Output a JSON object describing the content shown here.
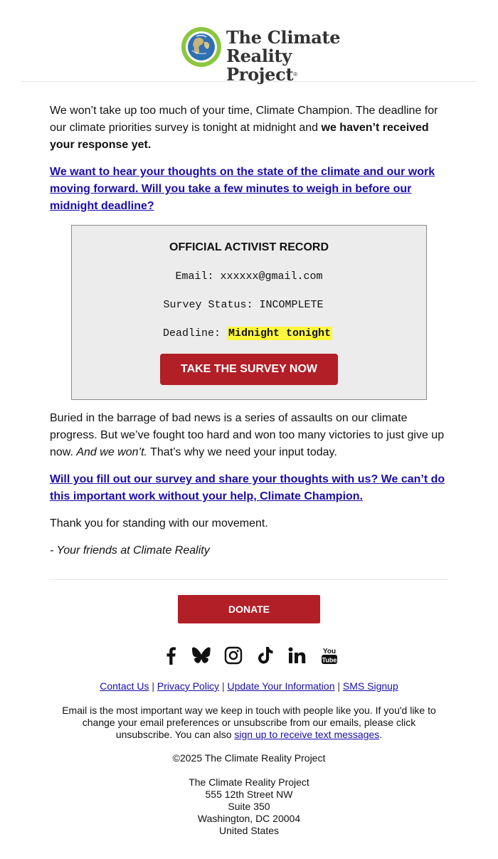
{
  "header": {
    "logo_line1": "The Climate",
    "logo_line2": "Reality Project",
    "logo_reg": "®"
  },
  "body": {
    "p1_normal": "We won’t take up too much of your time, Climate Champion. The deadline for our climate priorities survey is tonight at midnight and ",
    "p1_bold": "we haven’t received your response yet.",
    "link1": "We want to hear your thoughts on the state of the climate and our work moving forward. Will you take a few minutes to weigh in before our midnight deadline?",
    "p3_normal": "Buried in the barrage of bad news is a series of assaults on our climate progress. But we’ve fought too hard and won too many victories to just give up now. ",
    "p3_italic": "And we won’t.",
    "p3_end": " That’s why we need your input today.",
    "link2": "Will you fill out our survey and share your thoughts with us? We can’t do this important work without your help, Climate Champion.",
    "thanks": "Thank you for standing with our movement.",
    "signoff": "- Your friends at Climate Reality"
  },
  "record": {
    "title": "OFFICIAL ACTIVIST RECORD",
    "email_label": "Email: ",
    "email_value": "xxxxxx@gmail.com",
    "status_label": "Survey Status: ",
    "status_value": "INCOMPLETE",
    "deadline_label": "Deadline: ",
    "deadline_value": "Midnight tonight",
    "button_label": "TAKE THE SURVEY NOW"
  },
  "footer": {
    "donate_label": "DONATE",
    "social": [
      "facebook-icon",
      "bluesky-icon",
      "instagram-icon",
      "tiktok-icon",
      "linkedin-icon",
      "youtube-icon"
    ],
    "links": [
      "Contact Us",
      "Privacy Policy",
      "Update Your Information",
      "SMS Signup"
    ],
    "separator": "|",
    "note_text": "Email is the most important way we keep in touch with people like you. If you'd like to change your email preferences or unsubscribe from our emails, please click unsubscribe. You can also ",
    "note_link": "sign up to receive text messages",
    "note_end": ".",
    "copyright": "©2025 The Climate Reality Project",
    "address": [
      "The Climate Reality Project",
      "555 12th Street NW",
      "Suite 350",
      "Washington, DC 20004",
      "United States"
    ]
  },
  "colors": {
    "brand_red": "#b21f27",
    "link_blue": "#1a0dab",
    "highlight": "#fdf83c",
    "logo_green": "#8cc63f"
  }
}
